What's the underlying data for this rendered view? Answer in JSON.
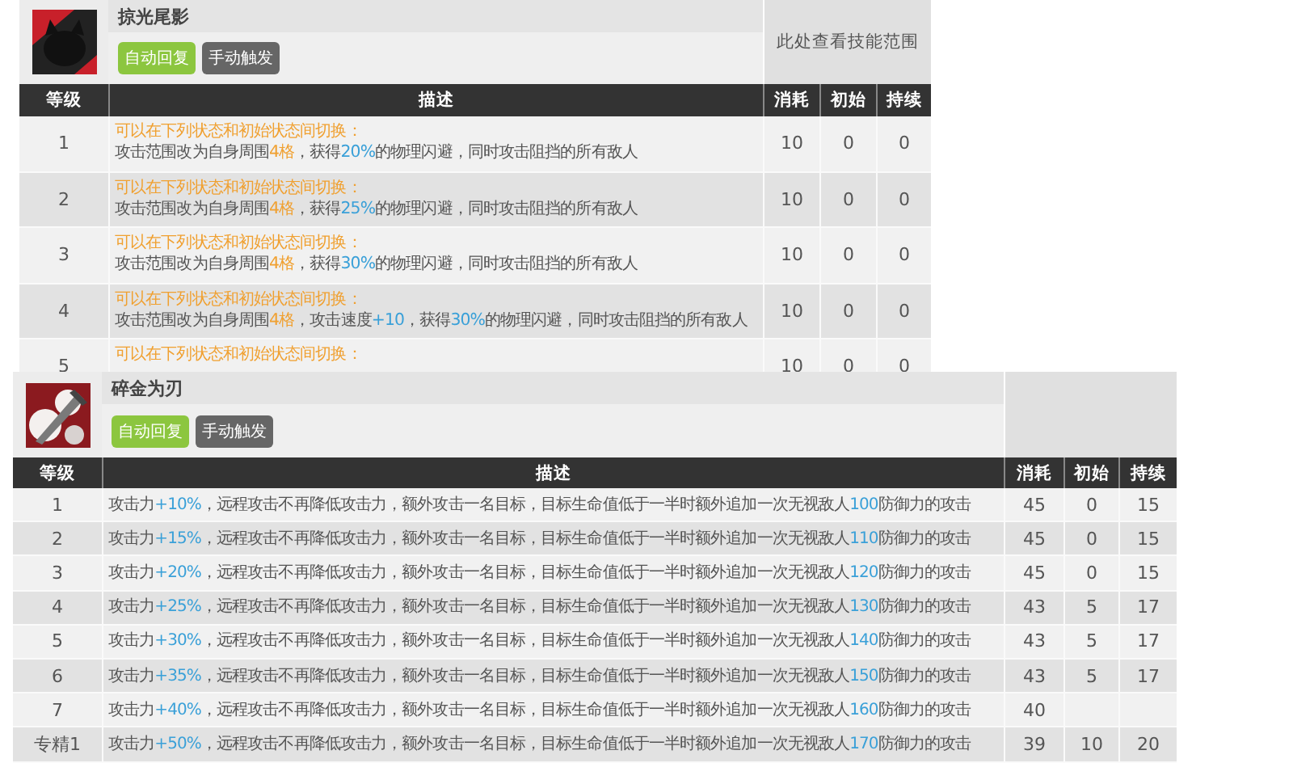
{
  "skills": [
    {
      "name": "掠光尾影",
      "tags": [
        {
          "label": "自动回复",
          "color": "#8cc63f"
        },
        {
          "label": "手动触发",
          "color": "#666666"
        }
      ],
      "range_link": "此处查看技能范围",
      "columns": [
        "等级",
        "描述",
        "消耗",
        "初始",
        "持续"
      ],
      "rows": [
        {
          "level": "1",
          "lines": [
            [
              {
                "kind": "orange",
                "text": "可以在下列状态和初始状态间切换："
              }
            ],
            [
              {
                "kind": "plain",
                "text": "攻击范围改为自身周围"
              },
              {
                "kind": "orange",
                "text": "4格"
              },
              {
                "kind": "plain",
                "text": "，获得"
              },
              {
                "kind": "blue",
                "text": "20%"
              },
              {
                "kind": "plain",
                "text": "的物理闪避，同时攻击阻挡的所有敌人"
              }
            ]
          ],
          "cost": "10",
          "initial": "0",
          "duration": "0"
        },
        {
          "level": "2",
          "lines": [
            [
              {
                "kind": "orange",
                "text": "可以在下列状态和初始状态间切换："
              }
            ],
            [
              {
                "kind": "plain",
                "text": "攻击范围改为自身周围"
              },
              {
                "kind": "orange",
                "text": "4格"
              },
              {
                "kind": "plain",
                "text": "，获得"
              },
              {
                "kind": "blue",
                "text": "25%"
              },
              {
                "kind": "plain",
                "text": "的物理闪避，同时攻击阻挡的所有敌人"
              }
            ]
          ],
          "cost": "10",
          "initial": "0",
          "duration": "0"
        },
        {
          "level": "3",
          "lines": [
            [
              {
                "kind": "orange",
                "text": "可以在下列状态和初始状态间切换："
              }
            ],
            [
              {
                "kind": "plain",
                "text": "攻击范围改为自身周围"
              },
              {
                "kind": "orange",
                "text": "4格"
              },
              {
                "kind": "plain",
                "text": "，获得"
              },
              {
                "kind": "blue",
                "text": "30%"
              },
              {
                "kind": "plain",
                "text": "的物理闪避，同时攻击阻挡的所有敌人"
              }
            ]
          ],
          "cost": "10",
          "initial": "0",
          "duration": "0"
        },
        {
          "level": "4",
          "lines": [
            [
              {
                "kind": "orange",
                "text": "可以在下列状态和初始状态间切换："
              }
            ],
            [
              {
                "kind": "plain",
                "text": "攻击范围改为自身周围"
              },
              {
                "kind": "orange",
                "text": "4格"
              },
              {
                "kind": "plain",
                "text": "，攻击速度"
              },
              {
                "kind": "blue",
                "text": "+10"
              },
              {
                "kind": "plain",
                "text": "，获得"
              },
              {
                "kind": "blue",
                "text": "30%"
              },
              {
                "kind": "plain",
                "text": "的物理闪避，同时攻击阻挡的所有敌人"
              }
            ]
          ],
          "cost": "10",
          "initial": "0",
          "duration": "0"
        },
        {
          "level": "5",
          "lines": [
            [
              {
                "kind": "orange",
                "text": "可以在下列状态和初始状态间切换："
              }
            ]
          ],
          "cost": "10",
          "initial": "0",
          "duration": "0"
        }
      ]
    },
    {
      "name": "碎金为刃",
      "tags": [
        {
          "label": "自动回复",
          "color": "#8cc63f"
        },
        {
          "label": "手动触发",
          "color": "#666666"
        }
      ],
      "columns": [
        "等级",
        "描述",
        "消耗",
        "初始",
        "持续"
      ],
      "rows": [
        {
          "level": "1",
          "lines": [
            [
              {
                "kind": "plain",
                "text": "攻击力"
              },
              {
                "kind": "blue",
                "text": "+10%"
              },
              {
                "kind": "plain",
                "text": "，远程攻击不再降低攻击力，额外攻击一名目标，目标生命值低于一半时额外追加一次无视敌人"
              },
              {
                "kind": "blue",
                "text": "100"
              },
              {
                "kind": "plain",
                "text": "防御力的攻击"
              }
            ]
          ],
          "cost": "45",
          "initial": "0",
          "duration": "15"
        },
        {
          "level": "2",
          "lines": [
            [
              {
                "kind": "plain",
                "text": "攻击力"
              },
              {
                "kind": "blue",
                "text": "+15%"
              },
              {
                "kind": "plain",
                "text": "，远程攻击不再降低攻击力，额外攻击一名目标，目标生命值低于一半时额外追加一次无视敌人"
              },
              {
                "kind": "blue",
                "text": "110"
              },
              {
                "kind": "plain",
                "text": "防御力的攻击"
              }
            ]
          ],
          "cost": "45",
          "initial": "0",
          "duration": "15"
        },
        {
          "level": "3",
          "lines": [
            [
              {
                "kind": "plain",
                "text": "攻击力"
              },
              {
                "kind": "blue",
                "text": "+20%"
              },
              {
                "kind": "plain",
                "text": "，远程攻击不再降低攻击力，额外攻击一名目标，目标生命值低于一半时额外追加一次无视敌人"
              },
              {
                "kind": "blue",
                "text": "120"
              },
              {
                "kind": "plain",
                "text": "防御力的攻击"
              }
            ]
          ],
          "cost": "45",
          "initial": "0",
          "duration": "15"
        },
        {
          "level": "4",
          "lines": [
            [
              {
                "kind": "plain",
                "text": "攻击力"
              },
              {
                "kind": "blue",
                "text": "+25%"
              },
              {
                "kind": "plain",
                "text": "，远程攻击不再降低攻击力，额外攻击一名目标，目标生命值低于一半时额外追加一次无视敌人"
              },
              {
                "kind": "blue",
                "text": "130"
              },
              {
                "kind": "plain",
                "text": "防御力的攻击"
              }
            ]
          ],
          "cost": "43",
          "initial": "5",
          "duration": "17"
        },
        {
          "level": "5",
          "lines": [
            [
              {
                "kind": "plain",
                "text": "攻击力"
              },
              {
                "kind": "blue",
                "text": "+30%"
              },
              {
                "kind": "plain",
                "text": "，远程攻击不再降低攻击力，额外攻击一名目标，目标生命值低于一半时额外追加一次无视敌人"
              },
              {
                "kind": "blue",
                "text": "140"
              },
              {
                "kind": "plain",
                "text": "防御力的攻击"
              }
            ]
          ],
          "cost": "43",
          "initial": "5",
          "duration": "17"
        },
        {
          "level": "6",
          "lines": [
            [
              {
                "kind": "plain",
                "text": "攻击力"
              },
              {
                "kind": "blue",
                "text": "+35%"
              },
              {
                "kind": "plain",
                "text": "，远程攻击不再降低攻击力，额外攻击一名目标，目标生命值低于一半时额外追加一次无视敌人"
              },
              {
                "kind": "blue",
                "text": "150"
              },
              {
                "kind": "plain",
                "text": "防御力的攻击"
              }
            ]
          ],
          "cost": "43",
          "initial": "5",
          "duration": "17"
        },
        {
          "level": "7",
          "lines": [
            [
              {
                "kind": "plain",
                "text": "攻击力"
              },
              {
                "kind": "blue",
                "text": "+40%"
              },
              {
                "kind": "plain",
                "text": "，远程攻击不再降低攻击力，额外攻击一名目标，目标生命值低于一半时额外追加一次无视敌人"
              },
              {
                "kind": "blue",
                "text": "160"
              },
              {
                "kind": "plain",
                "text": "防御力的攻击"
              }
            ]
          ],
          "cost": "40"
        },
        {
          "level": "专精1",
          "lines": [
            [
              {
                "kind": "plain",
                "text": "攻击力"
              },
              {
                "kind": "blue",
                "text": "+50%"
              },
              {
                "kind": "plain",
                "text": "，远程攻击不再降低攻击力，额外攻击一名目标，目标生命值低于一半时额外追加一次无视敌人"
              },
              {
                "kind": "blue",
                "text": "170"
              },
              {
                "kind": "plain",
                "text": "防御力的攻击"
              }
            ]
          ],
          "cost": "39",
          "initial": "10",
          "duration": "20"
        }
      ]
    }
  ]
}
